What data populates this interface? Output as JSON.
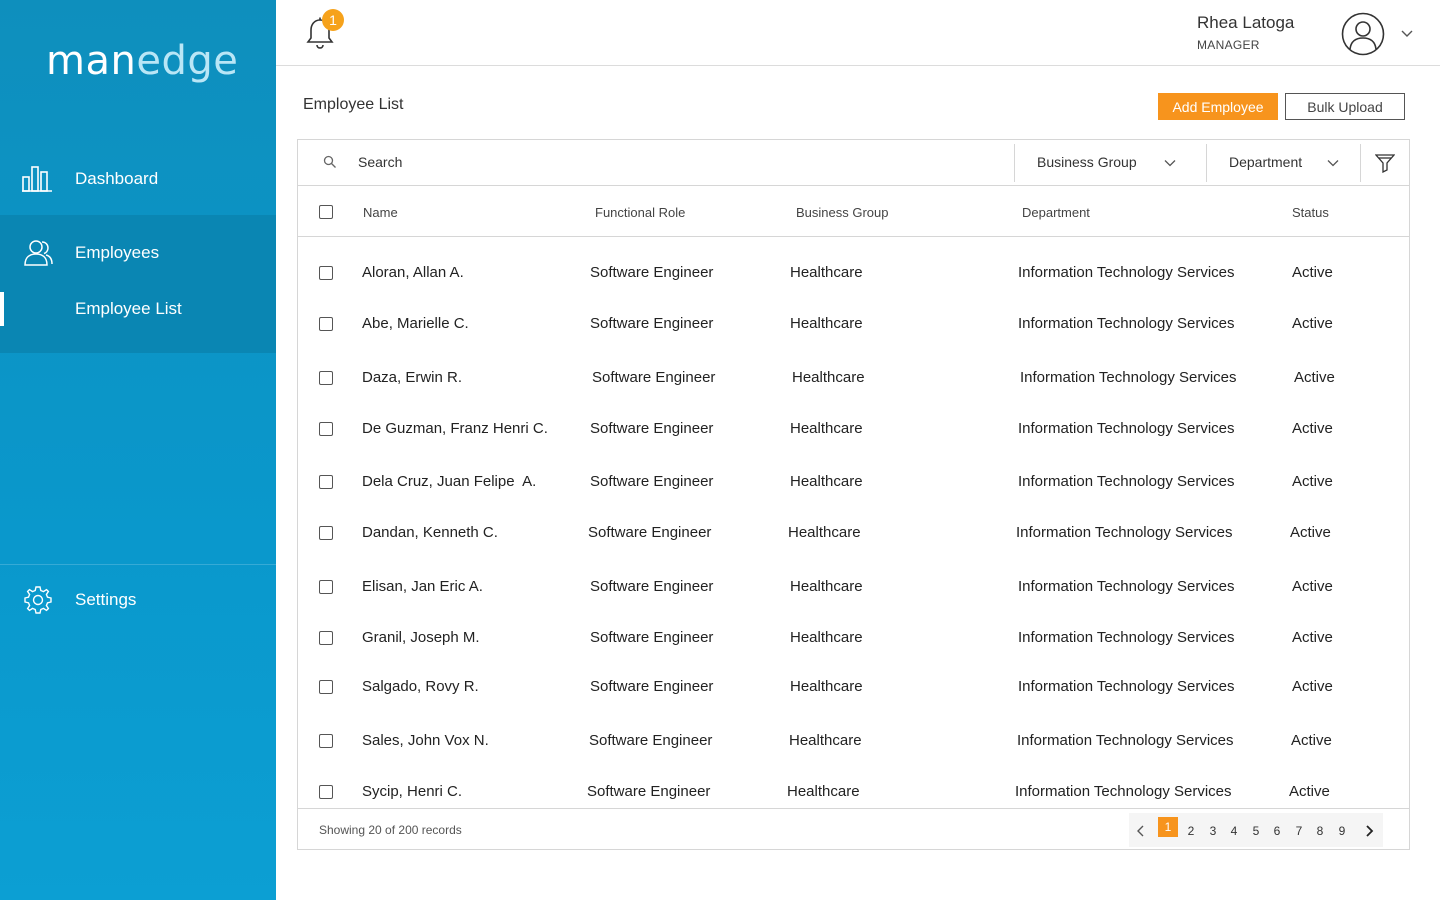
{
  "brand": {
    "part1": "man",
    "part2": "edge"
  },
  "sidebar": {
    "dashboard": {
      "label": "Dashboard",
      "icon": "bar-chart-icon"
    },
    "employees": {
      "label": "Employees",
      "icon": "users-icon"
    },
    "employee_list": {
      "label": "Employee List"
    },
    "settings": {
      "label": "Settings",
      "icon": "gear-icon"
    }
  },
  "header": {
    "notification_count": "1",
    "user_name": "Rhea Latoga",
    "user_role": "MANAGER"
  },
  "page": {
    "title": "Employee List",
    "add_button": "Add Employee",
    "bulk_button": "Bulk Upload"
  },
  "toolbar": {
    "search_placeholder": "Search",
    "business_group_filter": "Business Group",
    "department_filter": "Department"
  },
  "table": {
    "columns": [
      "Name",
      "Functional Role",
      "Business Group",
      "Department",
      "Status"
    ],
    "rows": [
      {
        "name": "Aloran, Allan A.",
        "role": "Software Engineer",
        "group": "Healthcare",
        "department": "Information Technology Services",
        "status": "Active"
      },
      {
        "name": "Abe, Marielle C.",
        "role": "Software Engineer",
        "group": "Healthcare",
        "department": "Information Technology Services",
        "status": "Active"
      },
      {
        "name": "Daza, Erwin R.",
        "role": "Software Engineer",
        "group": "Healthcare",
        "department": "Information Technology Services",
        "status": "Active"
      },
      {
        "name": "De Guzman, Franz Henri C.",
        "role": "Software Engineer",
        "group": "Healthcare",
        "department": "Information Technology Services",
        "status": "Active"
      },
      {
        "name": "Dela Cruz, Juan Felipe  A.",
        "role": "Software Engineer",
        "group": "Healthcare",
        "department": "Information Technology Services",
        "status": "Active"
      },
      {
        "name": "Dandan, Kenneth C.",
        "role": "Software Engineer",
        "group": "Healthcare",
        "department": "Information Technology Services",
        "status": "Active"
      },
      {
        "name": "Elisan, Jan Eric A.",
        "role": "Software Engineer",
        "group": "Healthcare",
        "department": "Information Technology Services",
        "status": "Active"
      },
      {
        "name": "Granil, Joseph M.",
        "role": "Software Engineer",
        "group": "Healthcare",
        "department": "Information Technology Services",
        "status": "Active"
      },
      {
        "name": "Salgado, Rovy R.",
        "role": "Software Engineer",
        "group": "Healthcare",
        "department": "Information Technology Services",
        "status": "Active"
      },
      {
        "name": "Sales, John Vox N.",
        "role": "Software Engineer",
        "group": "Healthcare",
        "department": "Information Technology Services",
        "status": "Active"
      },
      {
        "name": "Sycip, Henri C.",
        "role": "Software Engineer",
        "group": "Healthcare",
        "department": "Information Technology Services",
        "status": "Active"
      }
    ]
  },
  "footer": {
    "records_text": "Showing 20 of 200 records",
    "pages": [
      "1",
      "2",
      "3",
      "4",
      "5",
      "6",
      "7",
      "8",
      "9"
    ],
    "current_page": "1"
  },
  "colors": {
    "sidebar": "#0a98cc",
    "accent": "#f7941d",
    "active_nav": "#0a86b3"
  }
}
